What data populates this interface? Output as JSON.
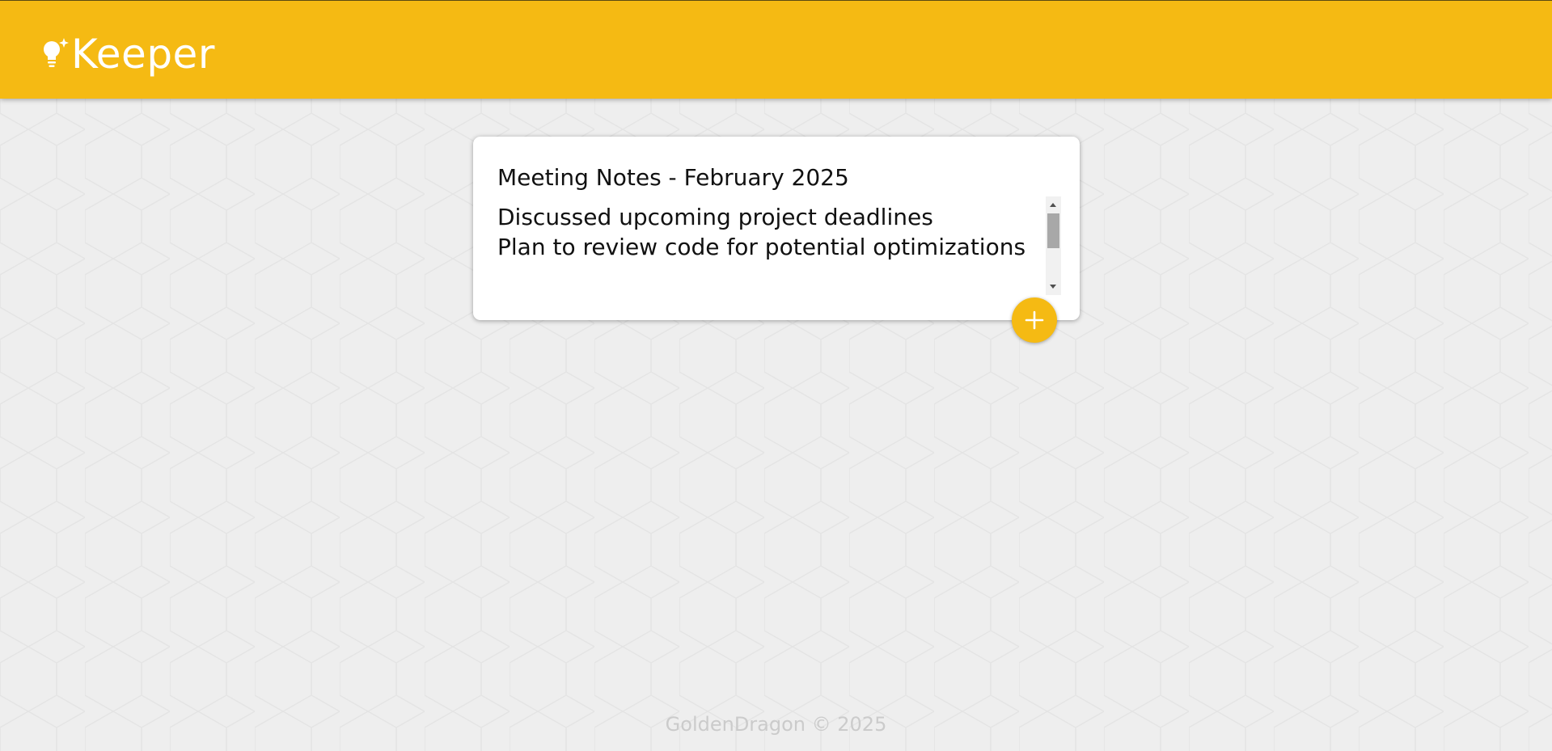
{
  "app": {
    "name": "Keeper",
    "brand_color": "#f5ba13",
    "background_color": "#eeeeee"
  },
  "header": {
    "logo_text": "Keeper",
    "logo_icon": "lightbulb-sparkle-icon"
  },
  "note_form": {
    "title_value": "Meeting Notes - February 2025",
    "content_lines": [
      "Discussed upcoming project deadlines",
      "Plan to review code for potential optimizations"
    ],
    "add_icon": "plus-icon"
  },
  "footer": {
    "text": "GoldenDragon © 2025"
  }
}
